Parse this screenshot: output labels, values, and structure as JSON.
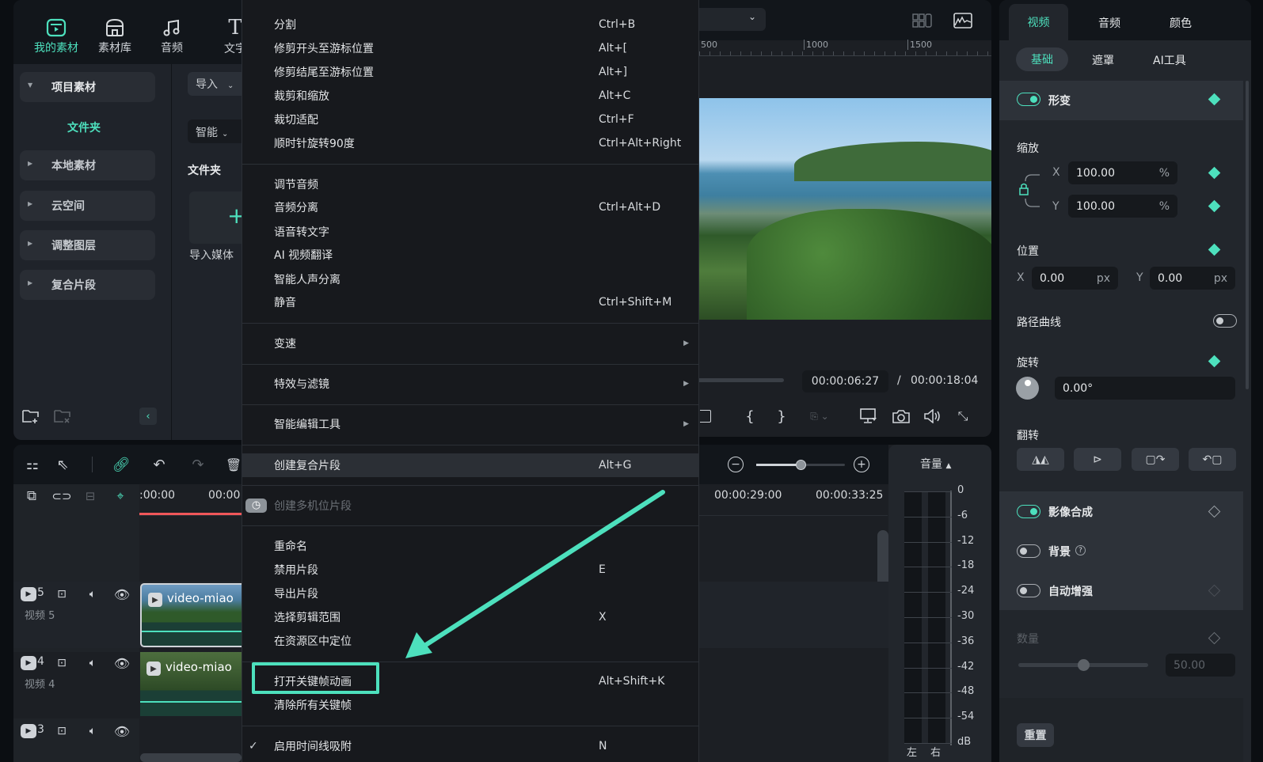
{
  "left_nav": {
    "tabs": [
      {
        "label": "我的素材",
        "icon": "my-media-icon",
        "active": true
      },
      {
        "label": "素材库",
        "icon": "store-icon"
      },
      {
        "label": "音频",
        "icon": "music-icon"
      },
      {
        "label": "文字",
        "icon": "text-icon"
      }
    ]
  },
  "media_tree": {
    "items": [
      {
        "label": "项目素材",
        "expanded": true
      },
      {
        "label": "本地素材"
      },
      {
        "label": "云空间"
      },
      {
        "label": "调整图层"
      },
      {
        "label": "复合片段"
      }
    ],
    "active_child": "文件夹"
  },
  "media_area": {
    "import_label": "导入",
    "sort_label": "智能",
    "folder_title": "文件夹",
    "import_media_label": "导入媒体"
  },
  "context_menu": {
    "groups": [
      [
        {
          "label": "分割",
          "shortcut": "Ctrl+B"
        },
        {
          "label": "修剪开头至游标位置",
          "shortcut": "Alt+["
        },
        {
          "label": "修剪结尾至游标位置",
          "shortcut": "Alt+]"
        },
        {
          "label": "裁剪和缩放",
          "shortcut": "Alt+C"
        },
        {
          "label": "裁切适配",
          "shortcut": "Ctrl+F"
        },
        {
          "label": "顺时针旋转90度",
          "shortcut": "Ctrl+Alt+Right"
        }
      ],
      [
        {
          "label": "调节音频",
          "shortcut": ""
        },
        {
          "label": "音频分离",
          "shortcut": "Ctrl+Alt+D"
        },
        {
          "label": "语音转文字",
          "shortcut": ""
        },
        {
          "label": "AI 视频翻译",
          "shortcut": ""
        },
        {
          "label": "智能人声分离",
          "shortcut": ""
        },
        {
          "label": "静音",
          "shortcut": "Ctrl+Shift+M"
        }
      ],
      [
        {
          "label": "变速",
          "shortcut": "",
          "submenu": true
        }
      ],
      [
        {
          "label": "特效与滤镜",
          "shortcut": "",
          "submenu": true
        }
      ],
      [
        {
          "label": "智能编辑工具",
          "shortcut": "",
          "submenu": true
        }
      ],
      [
        {
          "label": "创建复合片段",
          "shortcut": "Alt+G",
          "highlighted": true
        }
      ],
      [
        {
          "label": "创建多机位片段",
          "shortcut": "",
          "disabled": true
        }
      ],
      [
        {
          "label": "重命名",
          "shortcut": ""
        },
        {
          "label": "禁用片段",
          "shortcut": "E"
        },
        {
          "label": "导出片段",
          "shortcut": ""
        },
        {
          "label": "选择剪辑范围",
          "shortcut": "X"
        },
        {
          "label": "在资源区中定位",
          "shortcut": ""
        }
      ],
      [
        {
          "label": "打开关键帧动画",
          "shortcut": "Alt+Shift+K",
          "annotated": true
        },
        {
          "label": "清除所有关键帧",
          "shortcut": ""
        }
      ],
      [
        {
          "label": "启用时间线吸附",
          "shortcut": "N",
          "checked": true
        }
      ]
    ]
  },
  "preview": {
    "ruler_labels": [
      "500",
      "1000",
      "1500"
    ],
    "current_time": "00:00:06:27",
    "separator": "/",
    "total_time": "00:00:18:04"
  },
  "inspector": {
    "tabs": [
      {
        "label": "视频",
        "active": true
      },
      {
        "label": "音频"
      },
      {
        "label": "颜色"
      }
    ],
    "subtabs": [
      {
        "label": "基础",
        "active": true
      },
      {
        "label": "遮罩"
      },
      {
        "label": "AI工具"
      }
    ],
    "transform": {
      "label": "形变",
      "enabled": true
    },
    "scale": {
      "label": "缩放",
      "x_label": "X",
      "y_label": "Y",
      "x": "100.00",
      "y": "100.00",
      "unit": "%"
    },
    "position": {
      "label": "位置",
      "x_label": "X",
      "y_label": "Y",
      "x": "0.00",
      "y": "0.00",
      "unit": "px"
    },
    "path_curve": {
      "label": "路径曲线",
      "enabled": false
    },
    "rotation": {
      "label": "旋转",
      "value": "0.00°"
    },
    "flip": {
      "label": "翻转"
    },
    "compositing": {
      "label": "影像合成",
      "enabled": true
    },
    "background": {
      "label": "背景",
      "enabled": false
    },
    "auto_enhance": {
      "label": "自动增强",
      "enabled": false
    },
    "amount": {
      "label": "数量",
      "value": "50.00",
      "level": 0.5
    },
    "reset_label": "重置"
  },
  "timeline": {
    "ruler_labels": [
      ":00:00",
      "00:00:",
      "00:00:29:00",
      "00:00:33:25"
    ],
    "zoom_level": 0.5,
    "tracks": [
      {
        "number": "5",
        "name": "视频 5",
        "clip": "video-miao"
      },
      {
        "number": "4",
        "name": "视频 4",
        "clip": "video-miao"
      },
      {
        "number": "3",
        "name": "",
        "clip": ""
      }
    ]
  },
  "volume_meter": {
    "title": "音量",
    "scale": [
      "0",
      "-6",
      "-12",
      "-18",
      "-24",
      "-30",
      "-36",
      "-42",
      "-48",
      "-54",
      "dB"
    ],
    "channels": [
      "左",
      "右"
    ]
  },
  "colors": {
    "accent": "#4de0bd",
    "playhead": "#f0575a",
    "menu_bg": "#17191d"
  }
}
